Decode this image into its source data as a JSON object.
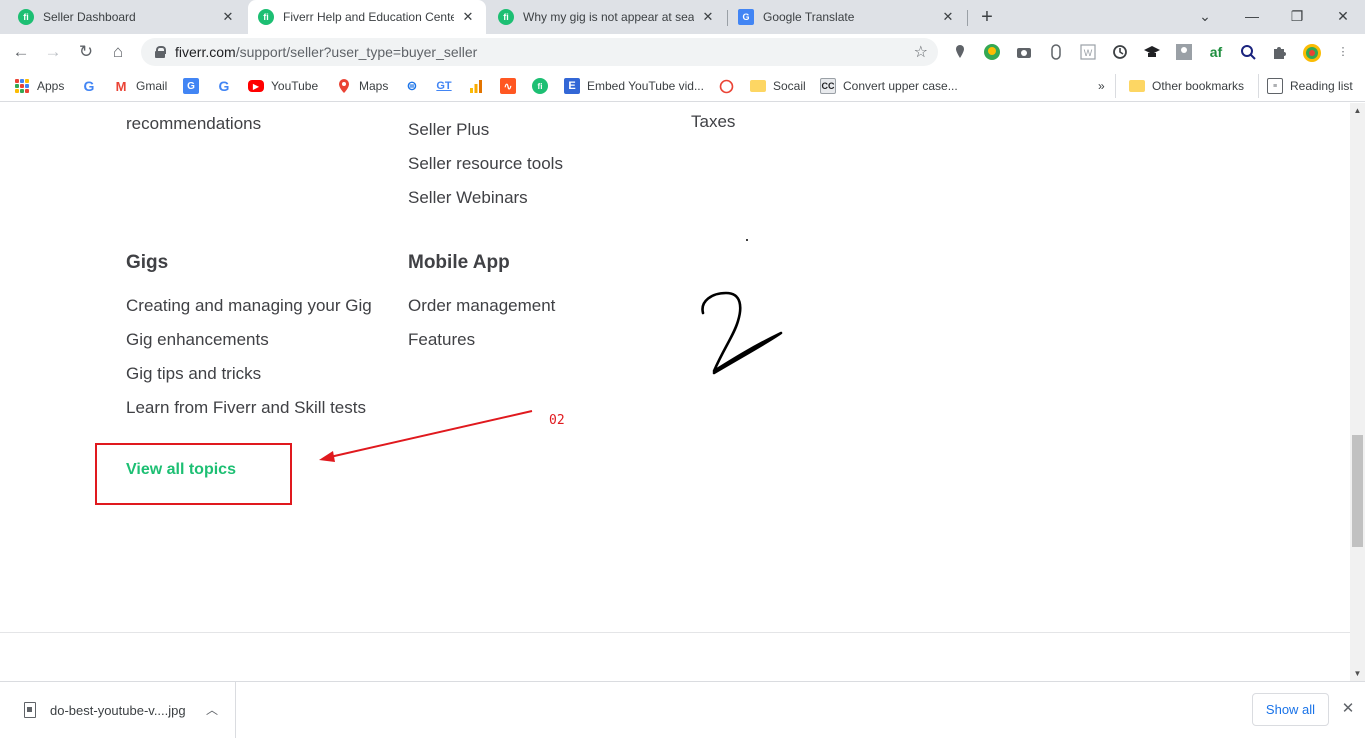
{
  "browser": {
    "tabs": [
      {
        "title": "Seller Dashboard",
        "favicon": "fiverr-icon",
        "active": false
      },
      {
        "title": "Fiverr Help and Education Center",
        "favicon": "fiverr-icon",
        "active": true
      },
      {
        "title": "Why my gig is not appear at sear",
        "favicon": "fiverr-icon",
        "active": false
      },
      {
        "title": "Google Translate",
        "favicon": "google-translate-icon",
        "active": false
      }
    ],
    "url_host": "fiverr.com",
    "url_path": "/support/seller?user_type=buyer_seller",
    "bookmarks": [
      {
        "label": "Apps",
        "icon": "apps-grid-icon"
      },
      {
        "label": "",
        "icon": "google-icon"
      },
      {
        "label": "Gmail",
        "icon": "gmail-icon"
      },
      {
        "label": "",
        "icon": "google-translate-icon"
      },
      {
        "label": "",
        "icon": "google-icon"
      },
      {
        "label": "YouTube",
        "icon": "youtube-icon"
      },
      {
        "label": "Maps",
        "icon": "maps-icon"
      },
      {
        "label": "",
        "icon": "globe-icon"
      },
      {
        "label": "",
        "icon": "gt-icon"
      },
      {
        "label": "",
        "icon": "analytics-icon"
      },
      {
        "label": "",
        "icon": "activity-icon"
      },
      {
        "label": "",
        "icon": "fiverr-icon"
      },
      {
        "label": "Embed YouTube vid...",
        "icon": "e-icon"
      },
      {
        "label": "",
        "icon": "circle-icon"
      },
      {
        "label": "Socail",
        "icon": "folder-icon"
      },
      {
        "label": "Convert upper case...",
        "icon": "cc-icon"
      }
    ],
    "bookmarks_more": "»",
    "other_bookmarks": "Other bookmarks",
    "reading_list": "Reading list"
  },
  "page": {
    "columns": [
      {
        "links": [
          "recommendations"
        ]
      },
      {
        "links": [
          "Seller Plus",
          "Seller resource tools",
          "Seller Webinars"
        ]
      },
      {
        "links": [
          "Taxes"
        ]
      }
    ],
    "sections": [
      {
        "heading": "Gigs",
        "links": [
          "Creating and managing your Gig",
          "Gig enhancements",
          "Gig tips and tricks",
          "Learn from Fiverr and Skill tests"
        ]
      },
      {
        "heading": "Mobile App",
        "links": [
          "Order management",
          "Features"
        ]
      }
    ],
    "view_all": "View all topics"
  },
  "annotations": {
    "label": "02",
    "color": "#e0191e"
  },
  "downloads": {
    "file_name": "do-best-youtube-v....jpg",
    "show_all": "Show all"
  }
}
